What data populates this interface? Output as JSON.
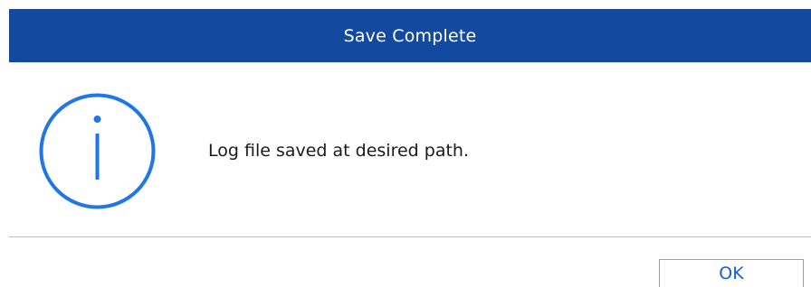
{
  "dialog": {
    "title": "Save Complete",
    "message": "Log file saved at desired path.",
    "ok_label": "OK",
    "icon": "info-icon"
  },
  "colors": {
    "titlebar": "#134aa0",
    "icon": "#1f77e6",
    "button_text": "#1b5fc9"
  }
}
